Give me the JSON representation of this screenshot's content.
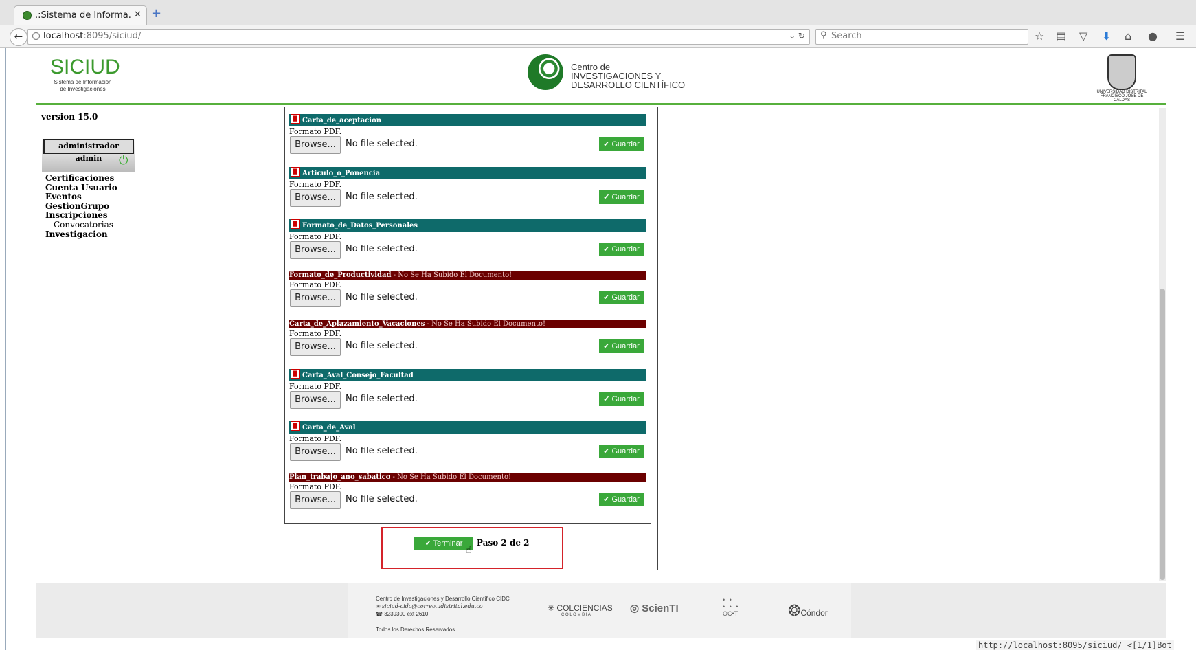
{
  "browser": {
    "tab_title": ".:Sistema de Informa...",
    "tab_close": "✕",
    "new_tab": "+",
    "url_host": "localhost",
    "url_rest": ":8095/siciud/",
    "search_placeholder": "Search",
    "status_url": "http://localhost:8095/siciud/ <[1/1]Bot"
  },
  "header": {
    "siciud_title": "SICIUD",
    "siciud_sub1": "Sistema de Información",
    "siciud_sub2": "de Investigaciones",
    "cidc_line1": "Centro de",
    "cidc_line2": "INVESTIGACIONES Y",
    "cidc_line3": "DESARROLLO CIENTÍFICO",
    "ud_line1": "UNIVERSIDAD DISTRITAL",
    "ud_line2": "FRANCISCO JOSÉ DE CALDAS"
  },
  "sidebar": {
    "version": "version 15.0",
    "user": "administrador admin",
    "menu": [
      "Certificaciones",
      "Cuenta Usuario",
      "Eventos",
      "GestionGrupo",
      "Inscripciones"
    ],
    "submenu": "Convocatorias",
    "menu_last": "Investigacion"
  },
  "documents": [
    {
      "name": "Carta_de_aceptacion",
      "status": "ok",
      "warning": "",
      "format": "Formato PDF.",
      "browse": "Browse...",
      "file": "No file selected.",
      "save": "Guardar"
    },
    {
      "name": "Articulo_o_Ponencia",
      "status": "ok",
      "warning": "",
      "format": "Formato PDF.",
      "browse": "Browse...",
      "file": "No file selected.",
      "save": "Guardar"
    },
    {
      "name": "Formato_de_Datos_Personales",
      "status": "ok",
      "warning": "",
      "format": "Formato PDF.",
      "browse": "Browse...",
      "file": "No file selected.",
      "save": "Guardar"
    },
    {
      "name": "Formato_de_Productividad",
      "status": "err",
      "warning": " - No Se Ha Subido El Documento!",
      "format": "Formato PDF.",
      "browse": "Browse...",
      "file": "No file selected.",
      "save": "Guardar"
    },
    {
      "name": "Carta_de_Aplazamiento_Vacaciones",
      "status": "err",
      "warning": " - No Se Ha Subido El Documento!",
      "format": "Formato PDF.",
      "browse": "Browse...",
      "file": "No file selected.",
      "save": "Guardar"
    },
    {
      "name": "Carta_Aval_Consejo_Facultad",
      "status": "ok",
      "warning": "",
      "format": "Formato PDF.",
      "browse": "Browse...",
      "file": "No file selected.",
      "save": "Guardar"
    },
    {
      "name": "Carta_de_Aval",
      "status": "ok",
      "warning": "",
      "format": "Formato PDF.",
      "browse": "Browse...",
      "file": "No file selected.",
      "save": "Guardar"
    },
    {
      "name": "Plan_trabajo_ano_sabatico",
      "status": "err",
      "warning": " - No Se Ha Subido El Documento!",
      "format": "Formato PDF.",
      "browse": "Browse...",
      "file": "No file selected.",
      "save": "Guardar"
    }
  ],
  "actions": {
    "finish": "Terminar",
    "step": "Paso 2 de 2"
  },
  "footer": {
    "org": "Centro de Investigaciones y Desarrollo Científico CIDC",
    "email": "siciud-cidc@correo.udistrital.edu.co",
    "phone": "3239300 ext 2610",
    "rights": "Todos los Derechos Reservados",
    "logo1": "COLCIENCIAS",
    "logo1_sub": "C O L O M B I A",
    "logo2": "ScienTI",
    "logo3": "OC•T",
    "logo4": "Cóndor"
  },
  "colors": {
    "ok_bar": "#0e6a6a",
    "err_bar": "#6b0000",
    "button_green": "#3aa83a",
    "brand_green": "#57b03c",
    "highlight_red": "#d4232a"
  }
}
